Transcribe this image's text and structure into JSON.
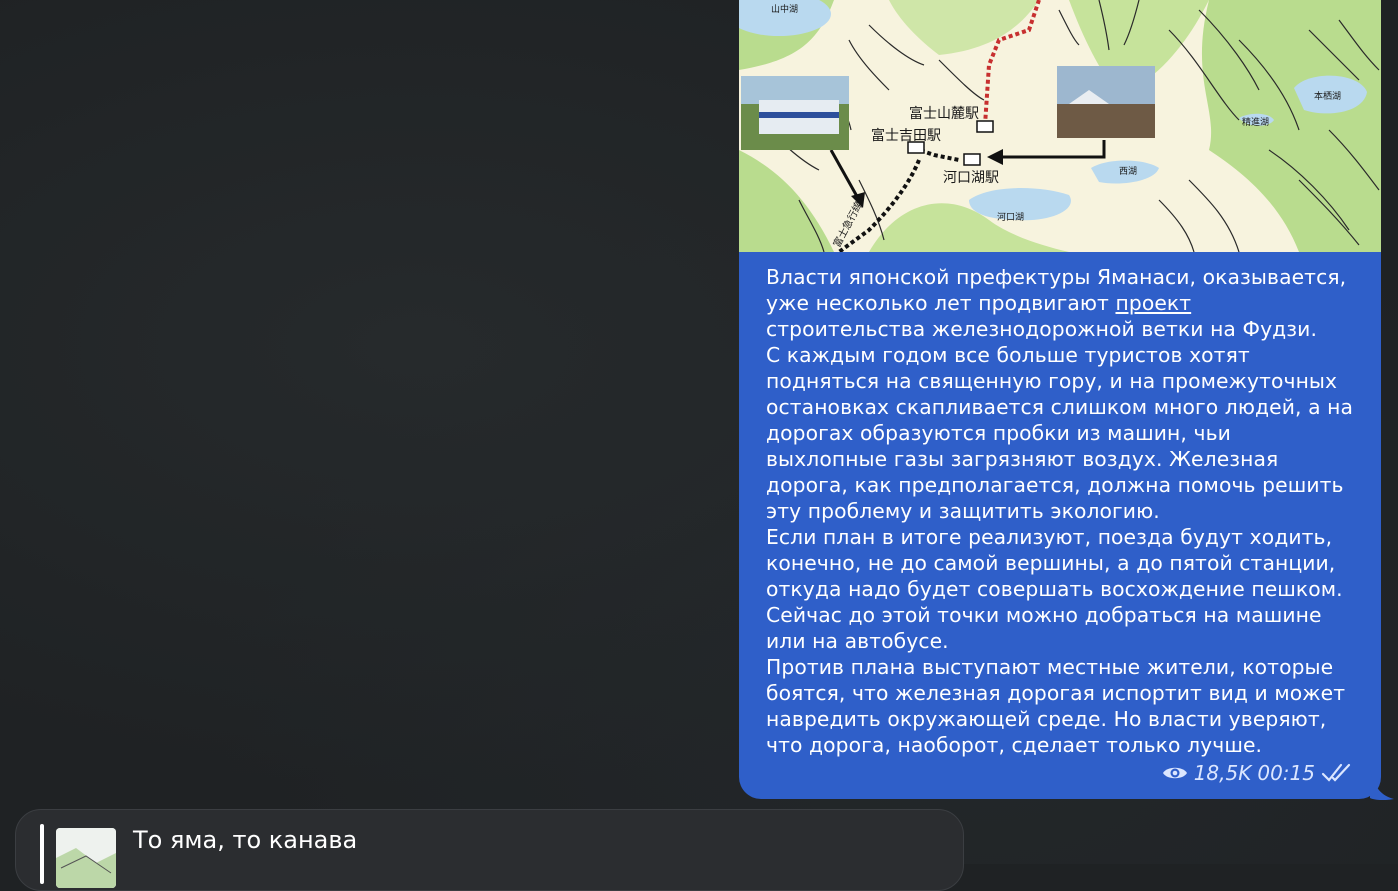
{
  "message": {
    "text_parts": [
      "Власти японской префектуры Яманаси, оказывается, уже несколько лет продвигают ",
      "проект",
      " строительства железнодорожной ветки на Фудзи."
    ],
    "paragraphs": [
      "С каждым годом все больше туристов хотят подняться на священную гору, и на промежуточных остановках скапливается слишком много людей, а на дорогах образуются пробки из машин, чьи выхлопные газы загрязняют воздух. Железная дорога, как предполагается, должна помочь решить эту проблему и защитить экологию.",
      "Если план в итоге реализуют, поезда будут ходить, конечно, не до самой вершины, а до пятой станции, откуда надо будет совершать восхождение пешком. Сейчас до этой точки можно добраться на машине или на автобусе.",
      "Против плана выступают местные жители, которые боятся, что железная дорогая испортит вид и может навредить окружающей среде. Но власти уверяют, что дорога, наоборот, сделает только лучше."
    ],
    "views": "18,5K",
    "time": "00:15",
    "status_icon": "double-check-icon",
    "views_icon": "eye-icon"
  },
  "map": {
    "labels": {
      "yamanaka": "山中湖",
      "fujisanroku": "富士山麓駅",
      "fujiyoshida": "富士吉田駅",
      "kawaguchiko_st": "河口湖駅",
      "kawaguchiko_lake": "河口湖",
      "saiko": "西湖",
      "shojiko": "精進湖",
      "motosuko": "本栖湖",
      "line_vertical": "富士急行線"
    }
  },
  "reply": {
    "title": "То яма, то канава"
  },
  "colors": {
    "bubble": "#2f5fc9",
    "background": "#1f2224",
    "card": "#2b2d30"
  }
}
